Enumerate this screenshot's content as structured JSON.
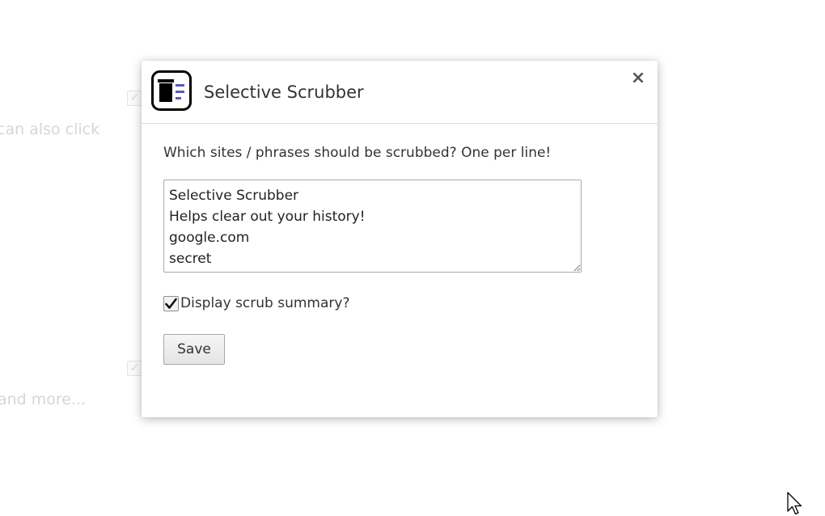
{
  "background": {
    "faded_text_1": "can also click",
    "faded_text_2": "and more..."
  },
  "dialog": {
    "title": "Selective Scrubber",
    "close_label": "×",
    "prompt": "Which sites / phrases should be scrubbed? One per line!",
    "textarea_value": "Selective Scrubber\nHelps clear out your history!\ngoogle.com\nsecret",
    "checkbox": {
      "label": "Display scrub summary?",
      "checked": true
    },
    "save_label": "Save"
  },
  "icons": {
    "logo": "trash-list-logo-icon",
    "close": "close-icon",
    "check": "checkmark-icon",
    "cursor": "mouse-pointer-icon"
  },
  "colors": {
    "logo_accent": "#5b5bb5",
    "text": "#333333"
  }
}
